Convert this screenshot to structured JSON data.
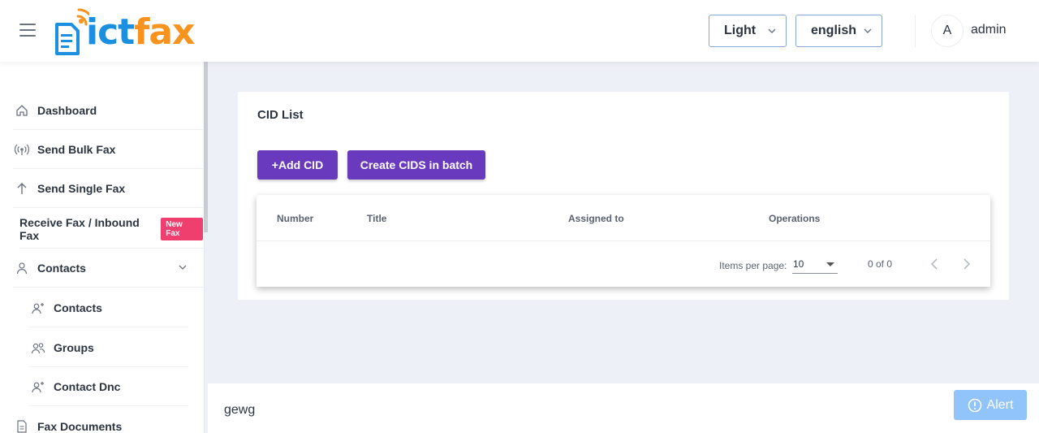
{
  "header": {
    "logo": {
      "part1": "ict",
      "part2": "fax"
    },
    "theme_select": {
      "value": "Light"
    },
    "lang_select": {
      "value": "english"
    },
    "user": {
      "avatar_initial": "A",
      "name": "admin"
    }
  },
  "sidebar": {
    "items": [
      {
        "label": "Dashboard",
        "icon": "home-icon"
      },
      {
        "label": "Send Bulk Fax",
        "icon": "broadcast-icon"
      },
      {
        "label": "Send Single Fax",
        "icon": "arrow-up-icon"
      },
      {
        "label": "Receive Fax / Inbound Fax",
        "badge": "New Fax"
      },
      {
        "label": "Contacts",
        "icon": "person-icon",
        "expanded": true
      },
      {
        "label": "Contacts",
        "icon": "person-add-icon",
        "sub": true
      },
      {
        "label": "Groups",
        "icon": "group-icon",
        "sub": true
      },
      {
        "label": "Contact Dnc",
        "icon": "person-add-icon",
        "sub": true
      },
      {
        "label": "Fax Documents",
        "icon": "document-icon"
      }
    ]
  },
  "main": {
    "card_title": "CID List",
    "buttons": {
      "add": "+Add CID",
      "batch": "Create CIDS in batch"
    },
    "table": {
      "columns": [
        "Number",
        "Title",
        "Assigned to",
        "Operations"
      ],
      "rows": []
    },
    "pagination": {
      "items_per_page_label": "Items per page:",
      "items_per_page_value": "10",
      "range": "0 of 0"
    }
  },
  "footer": {
    "text": "gewg"
  },
  "alert_button": {
    "label": "Alert"
  },
  "colors": {
    "primary": "#6a3abe",
    "logo_blue": "#1d8fe0",
    "logo_orange": "#f7931e",
    "badge": "#ee3f6f",
    "alert": "#90c4fb"
  }
}
